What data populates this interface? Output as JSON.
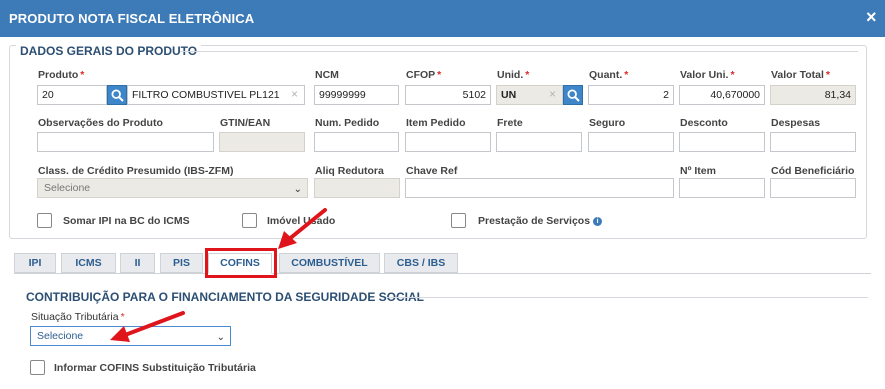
{
  "window": {
    "title": "PRODUTO NOTA FISCAL ELETRÔNICA",
    "close_glyph": "×"
  },
  "general": {
    "legend": "DADOS GERAIS DO PRODUTO",
    "produto": {
      "label": "Produto",
      "code": "20",
      "description": "FILTRO COMBUSTIVEL PL121",
      "clear_glyph": "×"
    },
    "ncm": {
      "label": "NCM",
      "value": "99999999"
    },
    "cfop": {
      "label": "CFOP",
      "value": "5102"
    },
    "unid": {
      "label": "Unid.",
      "value": "UN",
      "clear_glyph": "×"
    },
    "quant": {
      "label": "Quant.",
      "value": "2"
    },
    "valor_uni": {
      "label": "Valor Uni.",
      "value": "40,670000"
    },
    "valor_total": {
      "label": "Valor Total",
      "value": "81,34"
    },
    "required_mark": "*",
    "row2_labels": {
      "observacoes": "Observações do Produto",
      "gtin": "GTIN/EAN",
      "num_pedido": "Num. Pedido",
      "item_pedido": "Item Pedido",
      "frete": "Frete",
      "seguro": "Seguro",
      "desconto": "Desconto",
      "despesas": "Despesas"
    },
    "class_credito": {
      "label": "Class. de Crédito Presumido (IBS-ZFM)",
      "value": "Selecione"
    },
    "aliq_redutora": {
      "label": "Aliq Redutora"
    },
    "chave_ref": {
      "label": "Chave Ref"
    },
    "n_item": {
      "label": "Nº Item"
    },
    "cod_beneficiario": {
      "label": "Cód Beneficiário"
    },
    "checkboxes": {
      "somar_ipi": "Somar IPI na BC do ICMS",
      "imovel_usado": "Imóvel Usado",
      "prestacao_servicos": "Prestação de Serviços"
    },
    "info_glyph": "i"
  },
  "tabs": [
    "IPI",
    "ICMS",
    "II",
    "PIS",
    "COFINS",
    "COMBUSTÍVEL",
    "CBS / IBS"
  ],
  "active_tab": "COFINS",
  "cofins": {
    "section_title": "CONTRIBUIÇÃO PARA O FINANCIAMENTO DA SEGURIDADE SOCIAL",
    "situacao": {
      "label": "Situação Tributária",
      "value": "Selecione"
    },
    "substituicao_label": "Informar COFINS Substituição Tributária"
  },
  "colors": {
    "titlebar": "#3d7ab8",
    "accent": "#2c5e90",
    "highlight": "#e0141b"
  }
}
